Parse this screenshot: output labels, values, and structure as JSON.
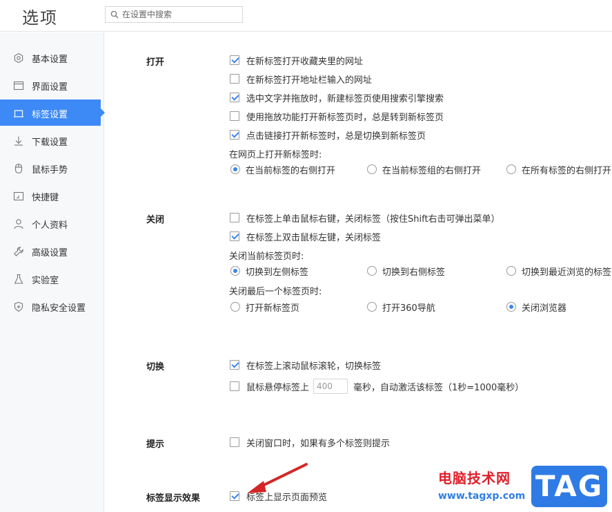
{
  "app": {
    "title": "选项"
  },
  "search": {
    "placeholder": "在设置中搜索"
  },
  "sidebar": {
    "items": [
      {
        "label": "基本设置",
        "icon": "hexagon-gear-icon"
      },
      {
        "label": "界面设置",
        "icon": "window-icon"
      },
      {
        "label": "标签设置",
        "icon": "tab-icon",
        "active": true
      },
      {
        "label": "下载设置",
        "icon": "download-icon"
      },
      {
        "label": "鼠标手势",
        "icon": "mouse-icon"
      },
      {
        "label": "快捷键",
        "icon": "keyboard-shortcut-icon"
      },
      {
        "label": "个人资料",
        "icon": "user-icon"
      },
      {
        "label": "高级设置",
        "icon": "wrench-icon"
      },
      {
        "label": "实验室",
        "icon": "flask-icon"
      },
      {
        "label": "隐私安全设置",
        "icon": "shield-icon"
      }
    ],
    "accent": "#3d8af7"
  },
  "sections": {
    "open": {
      "title": "打开",
      "options": [
        {
          "label": "在新标签打开收藏夹里的网址",
          "checked": true
        },
        {
          "label": "在新标签打开地址栏输入的网址",
          "checked": false
        },
        {
          "label": "选中文字并拖放时，新建标签页使用搜索引擎搜索",
          "checked": true
        },
        {
          "label": "使用拖放功能打开新标签页时，总是转到新标签页",
          "checked": false
        },
        {
          "label": "点击链接打开新标签时，总是切换到新标签页",
          "checked": true
        }
      ],
      "sub_label": "在网页上打开新标签时:",
      "radios": [
        {
          "label": "在当前标签的右侧打开",
          "checked": true
        },
        {
          "label": "在当前标签组的右侧打开",
          "checked": false
        },
        {
          "label": "在所有标签的右侧打开",
          "checked": false
        }
      ]
    },
    "close": {
      "title": "关闭",
      "options": [
        {
          "label": "在标签上单击鼠标右键，关闭标签（按住Shift右击可弹出菜单）",
          "checked": false
        },
        {
          "label": "在标签上双击鼠标左键，关闭标签",
          "checked": true
        }
      ],
      "sub_label_1": "关闭当前标签页时:",
      "radios_1": [
        {
          "label": "切换到左侧标签",
          "checked": true
        },
        {
          "label": "切换到右侧标签",
          "checked": false
        },
        {
          "label": "切换到最近浏览的标签",
          "checked": false
        }
      ],
      "sub_label_2": "关闭最后一个标签页时:",
      "radios_2": [
        {
          "label": "打开新标签页",
          "checked": false
        },
        {
          "label": "打开360导航",
          "checked": false
        },
        {
          "label": "关闭浏览器",
          "checked": true
        }
      ]
    },
    "switch": {
      "title": "切换",
      "options": [
        {
          "label": "在标签上滚动鼠标滚轮，切换标签",
          "checked": true
        }
      ],
      "hover": {
        "checked": false,
        "prefix": "鼠标悬停标签上",
        "value": "400",
        "suffix": "毫秒，自动激活该标签（1秒=1000毫秒）"
      }
    },
    "prompt": {
      "title": "提示",
      "options": [
        {
          "label": "关闭窗口时，如果有多个标签则提示",
          "checked": false
        }
      ]
    },
    "display": {
      "title": "标签显示效果",
      "options": [
        {
          "label": "标签上显示页面预览",
          "checked": true
        }
      ]
    }
  },
  "watermark": {
    "text_cn": "电脑技术网",
    "url": "www.tagxp.com",
    "badge": "TAG"
  }
}
